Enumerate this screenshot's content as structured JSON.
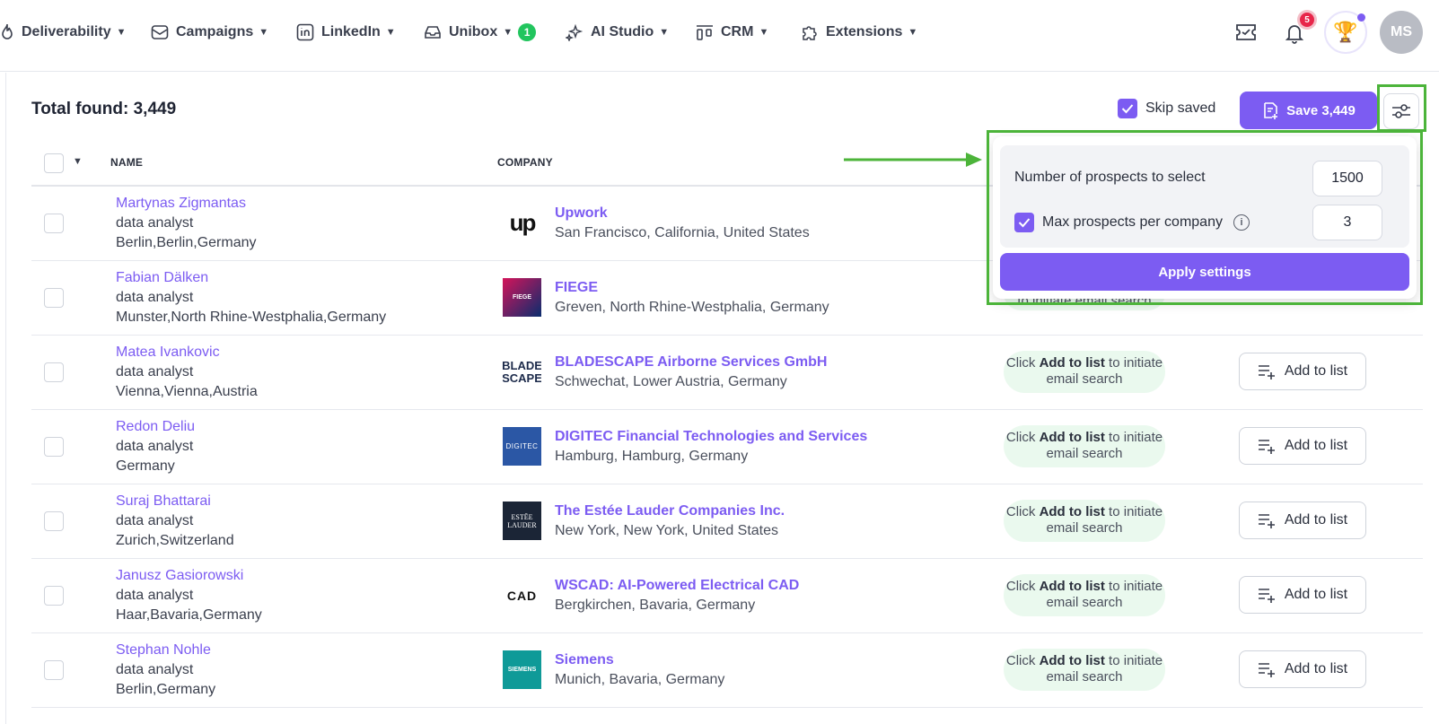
{
  "nav": {
    "items": [
      {
        "label": "Deliverability",
        "icon": "flame-icon"
      },
      {
        "label": "Campaigns",
        "icon": "mail-icon"
      },
      {
        "label": "LinkedIn",
        "icon": "linkedin-icon"
      },
      {
        "label": "Unibox",
        "icon": "inbox-icon",
        "badge": "1"
      },
      {
        "label": "AI Studio",
        "icon": "sparkle-icon"
      },
      {
        "label": "CRM",
        "icon": "crm-icon"
      },
      {
        "label": "Extensions",
        "icon": "puzzle-icon"
      }
    ],
    "notif_count": "5",
    "avatar_initials": "MS"
  },
  "toolbar": {
    "total_found": "Total found: 3,449",
    "skip_saved_label": "Skip saved",
    "save_label": "Save 3,449"
  },
  "table": {
    "col_name": "NAME",
    "col_company": "COMPANY",
    "rows": [
      {
        "name": "Martynas Zigmantas",
        "title": "data analyst",
        "location": "Berlin,Berlin,Germany",
        "company": "Upwork",
        "company_location": "San Francisco, California, United States",
        "logo": "upwork-logo"
      },
      {
        "name": "Fabian Dälken",
        "title": "data analyst",
        "location": "Munster,North Rhine-Westphalia,Germany",
        "company": "FIEGE",
        "company_location": "Greven, North Rhine-Westphalia, Germany",
        "logo": "fiege-logo"
      },
      {
        "name": "Matea Ivankovic",
        "title": "data analyst",
        "location": "Vienna,Vienna,Austria",
        "company": "BLADESCAPE Airborne Services GmbH",
        "company_location": "Schwechat, Lower Austria, Germany",
        "logo": "bladescape-logo"
      },
      {
        "name": "Redon Deliu",
        "title": "data analyst",
        "location": "Germany",
        "company": "DIGITEC Financial Technologies and Services",
        "company_location": "Hamburg, Hamburg, Germany",
        "logo": "digitec-logo"
      },
      {
        "name": "Suraj Bhattarai",
        "title": "data analyst",
        "location": "Zurich,Switzerland",
        "company": "The Estée Lauder Companies Inc.",
        "company_location": "New York, New York, United States",
        "logo": "estee-lauder-logo"
      },
      {
        "name": "Janusz Gasiorowski",
        "title": "data analyst",
        "location": "Haar,Bavaria,Germany",
        "company": "WSCAD: AI-Powered Electrical CAD",
        "company_location": "Bergkirchen, Bavaria, Germany",
        "logo": "wscad-logo"
      },
      {
        "name": "Stephan Nohle",
        "title": "data analyst",
        "location": "Berlin,Germany",
        "company": "Siemens",
        "company_location": "Munich, Bavaria, Germany",
        "logo": "siemens-logo"
      }
    ],
    "email_hint_pre": "Click ",
    "email_hint_bold": "Add to list",
    "email_hint_post": " to initiate email search",
    "add_to_list_label": "Add to list"
  },
  "popup": {
    "prospects_label": "Number of prospects to select",
    "prospects_value": "1500",
    "max_label": "Max prospects per company",
    "max_value": "3",
    "apply_label": "Apply settings"
  },
  "logo_text": {
    "upwork": "up",
    "fiege": "FIEGE",
    "bladescape_1": "BLADE",
    "bladescape_2": "SCAPE",
    "digitec": "DIGITEC",
    "estee_1": "ESTĒE",
    "estee_2": "LAUDER",
    "wscad": "CAD",
    "siemens": "SIEMENS"
  },
  "colors": {
    "accent": "#7c5cf2",
    "highlight": "#4cb43a",
    "success_bg": "#eaf9ee"
  }
}
